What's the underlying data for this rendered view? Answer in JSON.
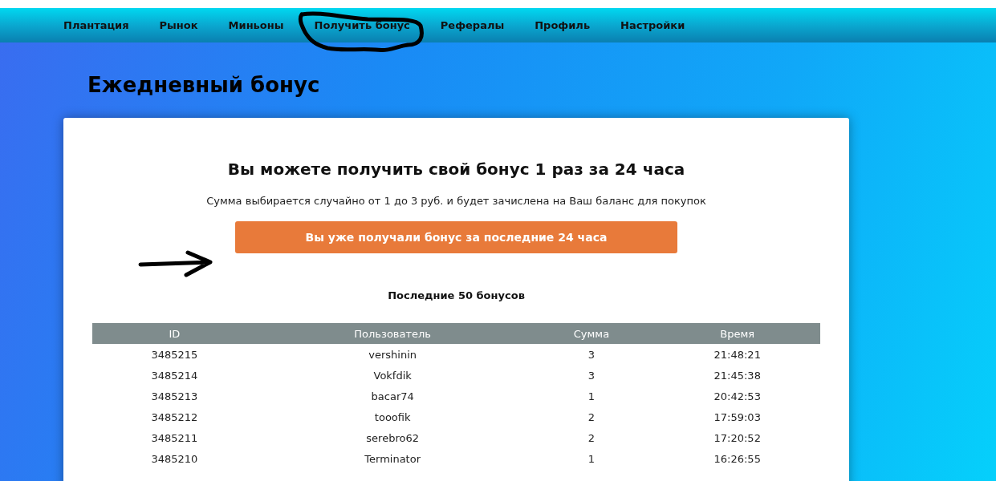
{
  "nav": [
    {
      "label": "Плантация"
    },
    {
      "label": "Рынок"
    },
    {
      "label": "Миньоны"
    },
    {
      "label": "Получить бонус"
    },
    {
      "label": "Рефералы"
    },
    {
      "label": "Профиль"
    },
    {
      "label": "Настройки"
    }
  ],
  "page_title": "Ежедневный бонус",
  "card": {
    "heading": "Вы можете получить свой бонус 1 раз за 24 часа",
    "description": "Сумма выбирается случайно от 1 до 3 руб. и будет зачислена на Ваш баланс для покупок",
    "button": {
      "label": "Вы уже получали бонус за последние 24 часа"
    },
    "table_title": "Последние 50 бонусов",
    "table": {
      "columns": [
        "ID",
        "Пользователь",
        "Сумма",
        "Время"
      ],
      "rows": [
        [
          "3485215",
          "vershinin",
          "3",
          "21:48:21"
        ],
        [
          "3485214",
          "Vokfdik",
          "3",
          "21:45:38"
        ],
        [
          "3485213",
          "bacar74",
          "1",
          "20:42:53"
        ],
        [
          "3485212",
          "tooofik",
          "2",
          "17:59:03"
        ],
        [
          "3485211",
          "serebro62",
          "2",
          "17:20:52"
        ],
        [
          "3485210",
          "Terminator",
          "1",
          "16:26:55"
        ]
      ]
    }
  }
}
